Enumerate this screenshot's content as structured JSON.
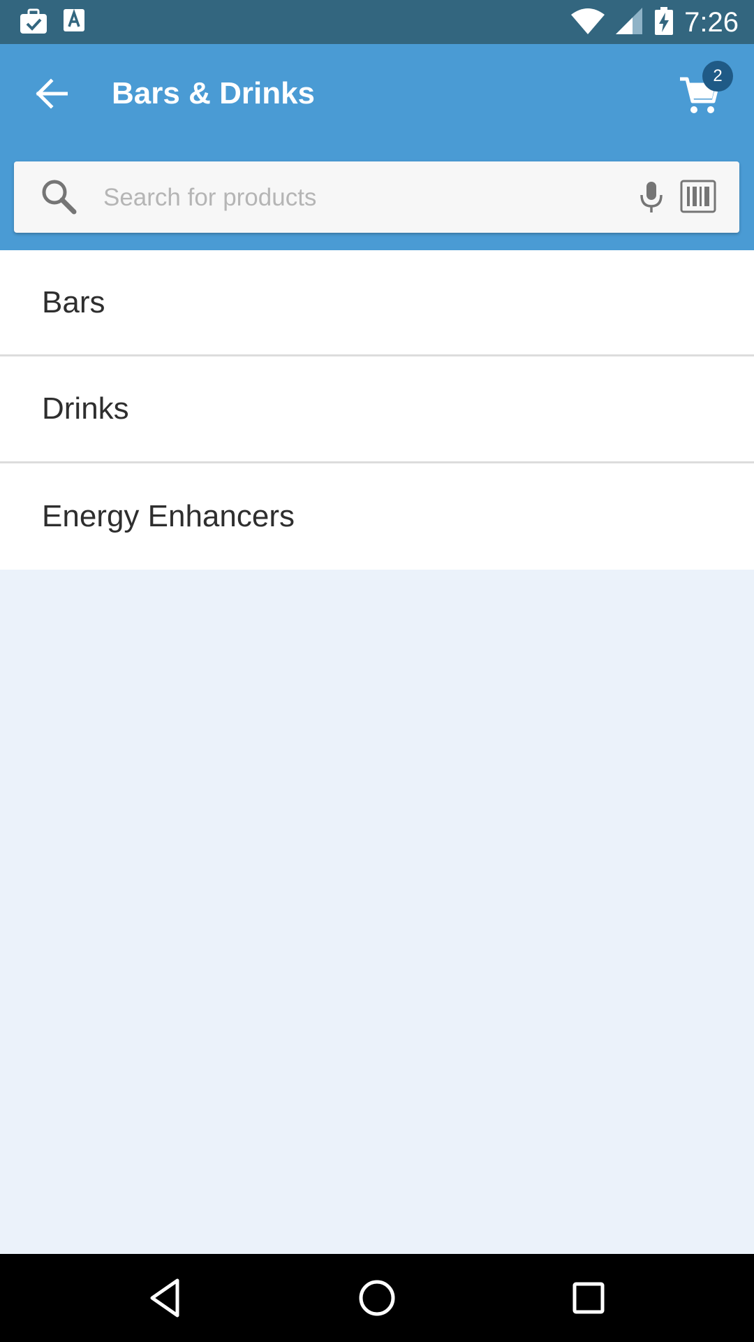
{
  "status_bar": {
    "time": "7:26",
    "icons": [
      "briefcase-check-icon",
      "font-a-icon",
      "wifi-icon",
      "signal-icon",
      "battery-charging-icon"
    ]
  },
  "header": {
    "title": "Bars & Drinks",
    "back_icon": "arrow-back-icon",
    "cart_icon": "cart-icon",
    "cart_count": "2",
    "background_color": "#4a9bd4"
  },
  "search": {
    "placeholder": "Search for products",
    "value": "",
    "icons": [
      "search-icon",
      "mic-icon",
      "barcode-icon"
    ]
  },
  "categories": [
    {
      "label": "Bars"
    },
    {
      "label": "Drinks"
    },
    {
      "label": "Energy Enhancers"
    }
  ],
  "nav_bar": {
    "icons": [
      "back-triangle-icon",
      "home-circle-icon",
      "recents-square-icon"
    ]
  }
}
